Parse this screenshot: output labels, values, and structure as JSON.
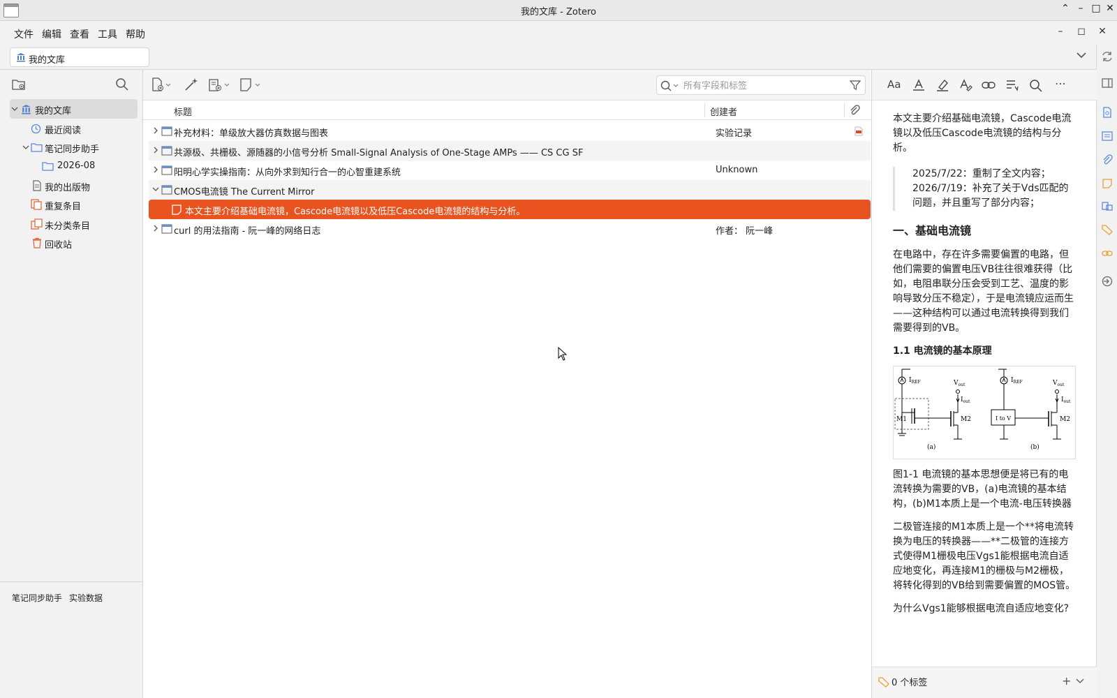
{
  "window": {
    "title": "我的文库 - Zotero"
  },
  "menu": {
    "items": [
      "文件",
      "编辑",
      "查看",
      "工具",
      "帮助"
    ]
  },
  "tabs": {
    "library": "我的文库"
  },
  "collections": {
    "items": [
      {
        "label": "我的文库",
        "icon": "library-icon"
      },
      {
        "label": "最近阅读",
        "icon": "clock-icon"
      },
      {
        "label": "笔记同步助手",
        "icon": "folder-icon"
      },
      {
        "label": "2026-08",
        "icon": "folder-icon"
      },
      {
        "label": "我的出版物",
        "icon": "publication-icon"
      },
      {
        "label": "重复条目",
        "icon": "duplicate-icon"
      },
      {
        "label": "未分类条目",
        "icon": "unfiled-icon"
      },
      {
        "label": "回收站",
        "icon": "trash-icon"
      }
    ]
  },
  "tag_selector": {
    "tags": [
      "笔记同步助手",
      "实验数据"
    ]
  },
  "search": {
    "placeholder": "所有字段和标签"
  },
  "columns": {
    "title": "标题",
    "creator": "创建者"
  },
  "items": [
    {
      "title": "补充材料：单级放大器仿真数据与图表",
      "creator": "实验记录",
      "has_pdf": true
    },
    {
      "title": "共源极、共栅极、源随器的小信号分析 Small-Signal Analysis of One-Stage AMPs —— CS CG SF",
      "creator": ""
    },
    {
      "title": "阳明心学实操指南：从向外求到知行合一的心智重建系统",
      "creator": "Unknown"
    },
    {
      "title": "CMOS电流镜 The Current Mirror",
      "creator": ""
    },
    {
      "title": "本文主要介绍基础电流镜，Cascode电流镜以及低压Cascode电流镜的结构与分析。",
      "creator": "",
      "child_note": true
    },
    {
      "title": "curl 的用法指南 - 阮一峰的网络日志",
      "creator": "作者： 阮一峰"
    }
  ],
  "note": {
    "intro": "本文主要介绍基础电流镜，Cascode电流镜以及低压Cascode电流镜的结构与分析。",
    "quote_line1": "2025/7/22：重制了全文内容；",
    "quote_line2": "2026/7/19：补充了关于Vds匹配的问题，并且重写了部分内容；",
    "h1": "一、基础电流镜",
    "para1": "在电路中，存在许多需要偏置的电路，但他们需要的偏置电压VB往往很难获得（比如，电阻串联分压会受到工艺、温度的影响导致分压不稳定），于是电流镜应运而生——这种结构可以通过电流转换得到我们需要得到的VB。",
    "h2": "1.1 电流镜的基本原理",
    "fig_labels": {
      "iref_a": "I",
      "iref_sub": "REF",
      "vout": "V",
      "vout_sub": "out",
      "iout": "I",
      "iout_sub": "out",
      "m1": "M1",
      "m2": "M2",
      "itov": "I to V",
      "a": "(a)",
      "b": "(b)"
    },
    "caption": "图1-1 电流镜的基本思想便是将已有的电流转换为需要的VB，(a)电流镜的基本结构，(b)M1本质上是一个电流-电压转换器",
    "para2": "二极管连接的M1本质上是一个**将电流转换为电压的转换器——**二极管的连接方式使得M1栅极电压Vgs1能根据电流自适应地变化，再连接M1的栅极与M2栅极，将转化得到的VB给到需要偏置的MOS管。",
    "para3": "为什么Vgs1能够根据电流自适应地变化?"
  },
  "note_footer": {
    "tags_count": "0 个标签"
  },
  "colors": {
    "selection": "#e9531f",
    "accent": "#e8652b"
  }
}
